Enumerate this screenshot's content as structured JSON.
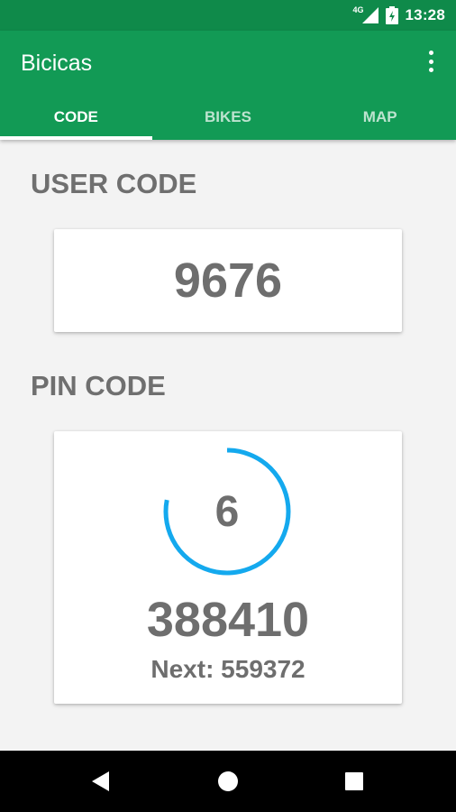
{
  "status_bar": {
    "network_type": "4G",
    "time": "13:28",
    "icons": [
      "signal-icon",
      "battery-charging-icon"
    ]
  },
  "app_bar": {
    "title": "Bicicas",
    "menu_icon": "more-vert-icon",
    "tabs": [
      {
        "label": "CODE",
        "active": true
      },
      {
        "label": "BIKES",
        "active": false
      },
      {
        "label": "MAP",
        "active": false
      }
    ]
  },
  "user_code": {
    "label": "USER CODE",
    "value": "9676"
  },
  "pin_code": {
    "label": "PIN CODE",
    "countdown": "6",
    "countdown_progress": 0.78,
    "value": "388410",
    "next": "Next: 559372"
  },
  "nav_bar": {
    "icons": [
      "back-icon",
      "home-icon",
      "recents-icon"
    ]
  },
  "colors": {
    "status_bar": "#0f8a4a",
    "app_bar": "#129a55",
    "timer_ring": "#14a9ee",
    "text_gray": "#6e6e6e",
    "background": "#f3f3f3"
  }
}
